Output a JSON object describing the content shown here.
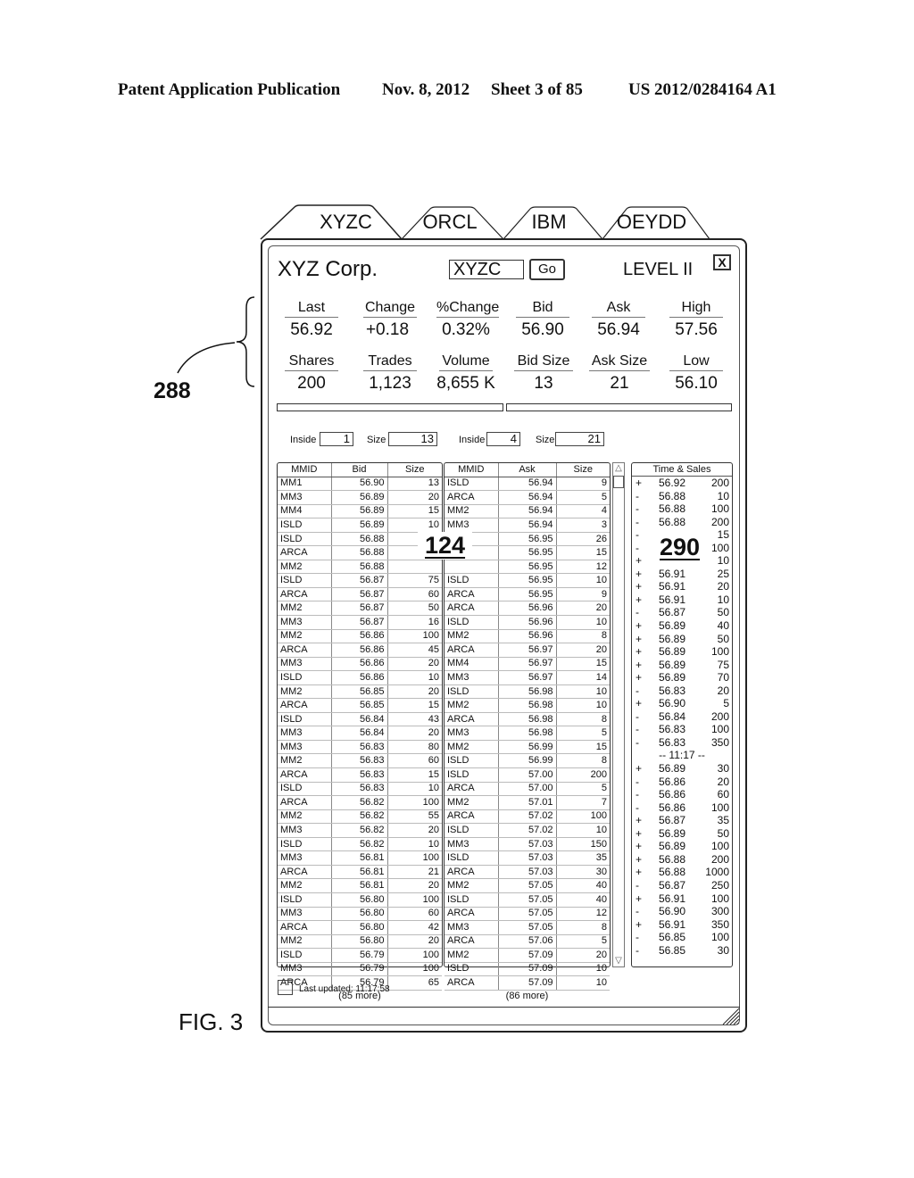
{
  "patent_header": {
    "left": "Patent Application Publication",
    "date": "Nov. 8, 2012",
    "sheet": "Sheet 3 of 85",
    "number": "US 2012/0284164 A1"
  },
  "reference_label": "288",
  "figure_label": "FIG. 3",
  "tabs": [
    {
      "label": "XYZC",
      "active": true
    },
    {
      "label": "ORCL",
      "active": false
    },
    {
      "label": "IBM",
      "active": false
    },
    {
      "label": "OEYDD",
      "active": false
    }
  ],
  "window": {
    "company": "XYZ Corp.",
    "symbol_value": "XYZC",
    "go_label": "Go",
    "level_label": "LEVEL II",
    "close_label": "X"
  },
  "quote": {
    "row1": [
      {
        "label": "Last",
        "value": "56.92"
      },
      {
        "label": "Change",
        "value": "+0.18"
      },
      {
        "label": "%Change",
        "value": "0.32%"
      },
      {
        "label": "Bid",
        "value": "56.90"
      },
      {
        "label": "Ask",
        "value": "56.94"
      },
      {
        "label": "High",
        "value": "57.56"
      }
    ],
    "row2": [
      {
        "label": "Shares",
        "value": "200"
      },
      {
        "label": "Trades",
        "value": "1,123"
      },
      {
        "label": "Volume",
        "value": "8,655 K"
      },
      {
        "label": "Bid Size",
        "value": "13"
      },
      {
        "label": "Ask Size",
        "value": "21"
      },
      {
        "label": "Low",
        "value": "56.10"
      }
    ]
  },
  "inside": {
    "bid_inside_label": "Inside",
    "bid_inside_value": "1",
    "bid_size_label": "Size",
    "bid_size_value": "13",
    "ask_inside_label": "Inside",
    "ask_inside_value": "4",
    "ask_size_label": "Size",
    "ask_size_value": "21"
  },
  "bid_book": {
    "headers": [
      "MMID",
      "Bid",
      "Size"
    ],
    "rows": [
      [
        "MM1",
        "56.90",
        "13"
      ],
      [
        "MM3",
        "56.89",
        "20"
      ],
      [
        "MM4",
        "56.89",
        "15"
      ],
      [
        "ISLD",
        "56.89",
        "10"
      ],
      [
        "ISLD",
        "56.88",
        ""
      ],
      [
        "ARCA",
        "56.88",
        ""
      ],
      [
        "MM2",
        "56.88",
        ""
      ],
      [
        "ISLD",
        "56.87",
        "75"
      ],
      [
        "ARCA",
        "56.87",
        "60"
      ],
      [
        "MM2",
        "56.87",
        "50"
      ],
      [
        "MM3",
        "56.87",
        "16"
      ],
      [
        "MM2",
        "56.86",
        "100"
      ],
      [
        "ARCA",
        "56.86",
        "45"
      ],
      [
        "MM3",
        "56.86",
        "20"
      ],
      [
        "ISLD",
        "56.86",
        "10"
      ],
      [
        "MM2",
        "56.85",
        "20"
      ],
      [
        "ARCA",
        "56.85",
        "15"
      ],
      [
        "ISLD",
        "56.84",
        "43"
      ],
      [
        "MM3",
        "56.84",
        "20"
      ],
      [
        "MM3",
        "56.83",
        "80"
      ],
      [
        "MM2",
        "56.83",
        "60"
      ],
      [
        "ARCA",
        "56.83",
        "15"
      ],
      [
        "ISLD",
        "56.83",
        "10"
      ],
      [
        "ARCA",
        "56.82",
        "100"
      ],
      [
        "MM2",
        "56.82",
        "55"
      ],
      [
        "MM3",
        "56.82",
        "20"
      ],
      [
        "ISLD",
        "56.82",
        "10"
      ],
      [
        "MM3",
        "56.81",
        "100"
      ],
      [
        "ARCA",
        "56.81",
        "21"
      ],
      [
        "MM2",
        "56.81",
        "20"
      ],
      [
        "ISLD",
        "56.80",
        "100"
      ],
      [
        "MM3",
        "56.80",
        "60"
      ],
      [
        "ARCA",
        "56.80",
        "42"
      ],
      [
        "MM2",
        "56.80",
        "20"
      ],
      [
        "ISLD",
        "56.79",
        "100"
      ],
      [
        "MM3",
        "56.79",
        "100"
      ],
      [
        "ARCA",
        "56.79",
        "65"
      ]
    ],
    "more": "(85 more)"
  },
  "ask_book": {
    "headers": [
      "MMID",
      "Ask",
      "Size"
    ],
    "rows": [
      [
        "ISLD",
        "56.94",
        "9"
      ],
      [
        "ARCA",
        "56.94",
        "5"
      ],
      [
        "MM2",
        "56.94",
        "4"
      ],
      [
        "MM3",
        "56.94",
        "3"
      ],
      [
        "",
        "56.95",
        "26"
      ],
      [
        "",
        "56.95",
        "15"
      ],
      [
        "",
        "56.95",
        "12"
      ],
      [
        "ISLD",
        "56.95",
        "10"
      ],
      [
        "ARCA",
        "56.95",
        "9"
      ],
      [
        "ARCA",
        "56.96",
        "20"
      ],
      [
        "ISLD",
        "56.96",
        "10"
      ],
      [
        "MM2",
        "56.96",
        "8"
      ],
      [
        "ARCA",
        "56.97",
        "20"
      ],
      [
        "MM4",
        "56.97",
        "15"
      ],
      [
        "MM3",
        "56.97",
        "14"
      ],
      [
        "ISLD",
        "56.98",
        "10"
      ],
      [
        "MM2",
        "56.98",
        "10"
      ],
      [
        "ARCA",
        "56.98",
        "8"
      ],
      [
        "MM3",
        "56.98",
        "5"
      ],
      [
        "MM2",
        "56.99",
        "15"
      ],
      [
        "ISLD",
        "56.99",
        "8"
      ],
      [
        "ISLD",
        "57.00",
        "200"
      ],
      [
        "ARCA",
        "57.00",
        "5"
      ],
      [
        "MM2",
        "57.01",
        "7"
      ],
      [
        "ARCA",
        "57.02",
        "100"
      ],
      [
        "ISLD",
        "57.02",
        "10"
      ],
      [
        "MM3",
        "57.03",
        "150"
      ],
      [
        "ISLD",
        "57.03",
        "35"
      ],
      [
        "ARCA",
        "57.03",
        "30"
      ],
      [
        "MM2",
        "57.05",
        "40"
      ],
      [
        "ISLD",
        "57.05",
        "40"
      ],
      [
        "ARCA",
        "57.05",
        "12"
      ],
      [
        "MM3",
        "57.05",
        "8"
      ],
      [
        "ARCA",
        "57.06",
        "5"
      ],
      [
        "MM2",
        "57.09",
        "20"
      ],
      [
        "ISLD",
        "57.09",
        "10"
      ],
      [
        "ARCA",
        "57.09",
        "10"
      ]
    ],
    "more": "(86 more)"
  },
  "scrollbar": {
    "up_icon": "△",
    "down_icon": "▽"
  },
  "time_sales": {
    "header": "Time & Sales",
    "rows": [
      [
        "+",
        "56.92",
        "200"
      ],
      [
        "-",
        "56.88",
        "10"
      ],
      [
        "-",
        "56.88",
        "100"
      ],
      [
        "-",
        "56.88",
        "200"
      ],
      [
        "-",
        "",
        "15"
      ],
      [
        "-",
        "",
        "100"
      ],
      [
        "+",
        "",
        "10"
      ],
      [
        "+",
        "56.91",
        "25"
      ],
      [
        "+",
        "56.91",
        "20"
      ],
      [
        "+",
        "56.91",
        "10"
      ],
      [
        "-",
        "56.87",
        "50"
      ],
      [
        "+",
        "56.89",
        "40"
      ],
      [
        "+",
        "56.89",
        "50"
      ],
      [
        "+",
        "56.89",
        "100"
      ],
      [
        "+",
        "56.89",
        "75"
      ],
      [
        "+",
        "56.89",
        "70"
      ],
      [
        "-",
        "56.83",
        "20"
      ],
      [
        "+",
        "56.90",
        "5"
      ],
      [
        "-",
        "56.84",
        "200"
      ],
      [
        "-",
        "56.83",
        "100"
      ],
      [
        "-",
        "56.83",
        "350"
      ],
      [
        "sep",
        "-- 11:17 --",
        ""
      ],
      [
        "+",
        "56.89",
        "30"
      ],
      [
        "-",
        "56.86",
        "20"
      ],
      [
        "-",
        "56.86",
        "60"
      ],
      [
        "-",
        "56.86",
        "100"
      ],
      [
        "+",
        "56.87",
        "35"
      ],
      [
        "+",
        "56.89",
        "50"
      ],
      [
        "+",
        "56.89",
        "100"
      ],
      [
        "+",
        "56.88",
        "200"
      ],
      [
        "+",
        "56.88",
        "1000"
      ],
      [
        "-",
        "56.87",
        "250"
      ],
      [
        "+",
        "56.91",
        "100"
      ],
      [
        "-",
        "56.90",
        "300"
      ],
      [
        "+",
        "56.91",
        "350"
      ],
      [
        "-",
        "56.85",
        "100"
      ],
      [
        "-",
        "56.85",
        "30"
      ]
    ]
  },
  "callouts": {
    "book": "124",
    "time_sales": "290"
  },
  "status": {
    "text": "Last updated:  11:17:58"
  }
}
